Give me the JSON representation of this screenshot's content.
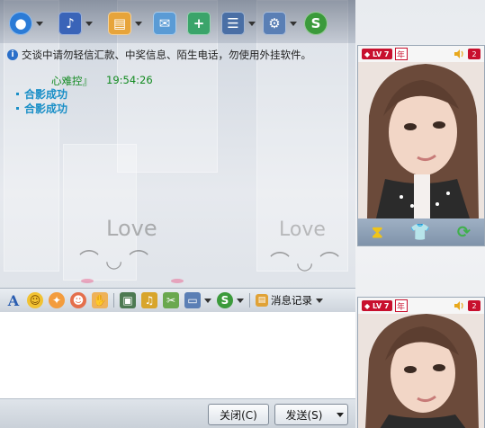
{
  "toolbar": {
    "items": [
      {
        "name": "video-call",
        "icon": "camera-icon",
        "glyph": "●",
        "color": "#2b7bd6"
      },
      {
        "name": "voice-call",
        "icon": "microphone-icon",
        "glyph": "♪",
        "color": "#3a64b8"
      },
      {
        "name": "send-file",
        "icon": "folder-icon",
        "glyph": "▤",
        "color": "#e7a43a"
      },
      {
        "name": "send-mail",
        "icon": "mail-icon",
        "glyph": "✉",
        "color": "#5a9bd5"
      },
      {
        "name": "create-group",
        "icon": "add-note-icon",
        "glyph": "+",
        "color": "#3aa46a"
      },
      {
        "name": "contacts",
        "icon": "person-card-icon",
        "glyph": "☰",
        "color": "#4a6fa5"
      },
      {
        "name": "settings",
        "icon": "settings-icon",
        "glyph": "⚙",
        "color": "#5a7fb5"
      },
      {
        "name": "pay",
        "icon": "s-coin-icon",
        "glyph": "S",
        "color": "#3b9a3b"
      }
    ]
  },
  "notice": {
    "icon": "info-icon",
    "text": "交谈中请勿轻信汇款、中奖信息、陌生电话，勿使用外挂软件。"
  },
  "chat": {
    "sender": "心难控』",
    "time": "19:54:26",
    "messages": [
      "合影成功",
      "合影成功"
    ],
    "watermark": "Love"
  },
  "format_bar": {
    "font_label": "A",
    "record_label": "消息记录"
  },
  "buttons": {
    "close": "关闭(C)",
    "send": "发送(S)"
  },
  "video": {
    "level_badge": "LV 7",
    "year_badge": "年",
    "count_badge": "2",
    "colors": {
      "badge": "#c8102e",
      "hair": "#6b4a3a",
      "skin": "#f0d4c4",
      "bg": "#e9e2de"
    }
  }
}
